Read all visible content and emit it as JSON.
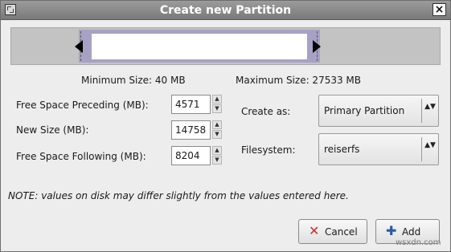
{
  "dialog": {
    "title": "Create new Partition",
    "close_icon": "×"
  },
  "sizes": {
    "minimum": "Minimum Size: 40 MB",
    "maximum": "Maximum Size: 27533 MB"
  },
  "fields": {
    "preceding_label": "Free Space Preceding (MB):",
    "preceding_value": "4571",
    "new_size_label": "New Size (MB):",
    "new_size_value": "14758",
    "following_label": "Free Space Following (MB):",
    "following_value": "8204"
  },
  "options": {
    "create_as_label": "Create as:",
    "create_as_value": "Primary Partition",
    "filesystem_label": "Filesystem:",
    "filesystem_value": "reiserfs"
  },
  "note": "NOTE: values on disk may differ slightly from the values entered here.",
  "buttons": {
    "cancel_label": "Cancel",
    "add_label": "Add"
  },
  "icons": {
    "spin_up": "▲",
    "spin_down": "▼",
    "combo_toggle": "▲▼",
    "cancel": "✕",
    "add": "✚"
  },
  "colors": {
    "used_partition": "#a7a1c6",
    "unallocated": "#c3c3c3",
    "cancel_icon": "#c8302f",
    "add_icon": "#2b5aa6"
  },
  "watermark": "wsxdn.com"
}
